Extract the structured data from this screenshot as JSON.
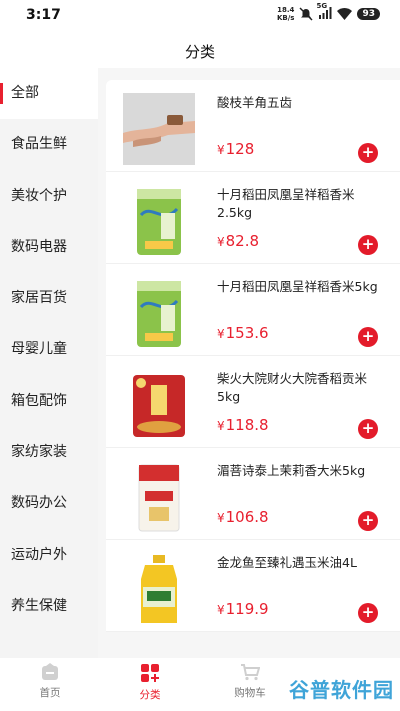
{
  "status_bar": {
    "time": "3:17",
    "net_speed_top": "18.4",
    "net_speed_unit": "KB/s",
    "network": "5G",
    "battery": "93"
  },
  "header": {
    "title": "分类"
  },
  "sidebar": {
    "items": [
      {
        "label": "全部",
        "active": true
      },
      {
        "label": "食品生鲜"
      },
      {
        "label": "美妆个护"
      },
      {
        "label": "数码电器"
      },
      {
        "label": "家居百货"
      },
      {
        "label": "母婴儿童"
      },
      {
        "label": "箱包配饰"
      },
      {
        "label": "家纺家装"
      },
      {
        "label": "数码办公"
      },
      {
        "label": "运动户外"
      },
      {
        "label": "养生保健"
      }
    ]
  },
  "products": [
    {
      "name": "酸枝羊角五齿",
      "currency": "¥",
      "price": "128",
      "image": "wrist-massage-photo"
    },
    {
      "name": "十月稻田凤凰呈祥稻香米2.5kg",
      "currency": "¥",
      "price": "82.8",
      "image": "rice-bag-green"
    },
    {
      "name": "十月稻田凤凰呈祥稻香米5kg",
      "currency": "¥",
      "price": "153.6",
      "image": "rice-bag-green"
    },
    {
      "name": "柴火大院财火大院香稻贡米5kg",
      "currency": "¥",
      "price": "118.8",
      "image": "rice-bag-red"
    },
    {
      "name": "湄菩诗泰上茉莉香大米5kg",
      "currency": "¥",
      "price": "106.8",
      "image": "rice-bag-white"
    },
    {
      "name": "金龙鱼至臻礼遇玉米油4L",
      "currency": "¥",
      "price": "119.9",
      "image": "oil-bottle"
    }
  ],
  "tabbar": {
    "tabs": [
      {
        "label": "首页",
        "icon": "home-icon"
      },
      {
        "label": "分类",
        "icon": "category-icon",
        "active": true
      },
      {
        "label": "购物车",
        "icon": "cart-icon"
      }
    ]
  },
  "watermark": "谷普软件园",
  "colors": {
    "accent": "#e8202f",
    "sidebar_bg": "#f4f4f4"
  }
}
